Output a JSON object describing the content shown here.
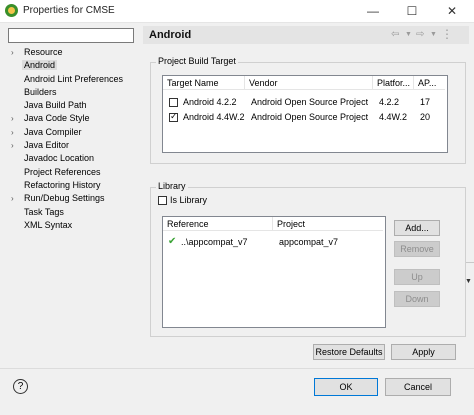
{
  "window": {
    "title": "Properties for CMSE",
    "minimize": "—",
    "maximize": "☐",
    "close": "✕"
  },
  "filter": {
    "value": ""
  },
  "tree": {
    "items": [
      {
        "label": "Resource",
        "expandable": true,
        "selected": false
      },
      {
        "label": "Android",
        "expandable": false,
        "selected": true
      },
      {
        "label": "Android Lint Preferences",
        "expandable": false,
        "selected": false
      },
      {
        "label": "Builders",
        "expandable": false,
        "selected": false
      },
      {
        "label": "Java Build Path",
        "expandable": false,
        "selected": false
      },
      {
        "label": "Java Code Style",
        "expandable": true,
        "selected": false
      },
      {
        "label": "Java Compiler",
        "expandable": true,
        "selected": false
      },
      {
        "label": "Java Editor",
        "expandable": true,
        "selected": false
      },
      {
        "label": "Javadoc Location",
        "expandable": false,
        "selected": false
      },
      {
        "label": "Project References",
        "expandable": false,
        "selected": false
      },
      {
        "label": "Refactoring History",
        "expandable": false,
        "selected": false
      },
      {
        "label": "Run/Debug Settings",
        "expandable": true,
        "selected": false
      },
      {
        "label": "Task Tags",
        "expandable": false,
        "selected": false
      },
      {
        "label": "XML Syntax",
        "expandable": false,
        "selected": false
      }
    ]
  },
  "page": {
    "title": "Android"
  },
  "build_target": {
    "group_title": "Project Build Target",
    "columns": [
      "Target Name",
      "Vendor",
      "Platfor...",
      "AP..."
    ],
    "rows": [
      {
        "checked": false,
        "name": "Android 4.2.2",
        "vendor": "Android Open Source Project",
        "platform": "4.2.2",
        "api": "17"
      },
      {
        "checked": true,
        "name": "Android 4.4W.2",
        "vendor": "Android Open Source Project",
        "platform": "4.4W.2",
        "api": "20"
      }
    ]
  },
  "library": {
    "group_title": "Library",
    "is_library_label": "Is Library",
    "is_library_checked": false,
    "columns": [
      "Reference",
      "Project"
    ],
    "rows": [
      {
        "reference": "..\\appcompat_v7",
        "project": "appcompat_v7",
        "status": "ok"
      }
    ],
    "buttons": {
      "add": "Add...",
      "remove": "Remove",
      "up": "Up",
      "down": "Down"
    }
  },
  "actions": {
    "restore_defaults": "Restore Defaults",
    "apply": "Apply"
  },
  "dialog": {
    "ok": "OK",
    "cancel": "Cancel",
    "help": "?"
  },
  "colors": {
    "check_ok": "#3aa335",
    "primary_border": "#0078d7",
    "selected_bg": "#dcdcdc"
  }
}
